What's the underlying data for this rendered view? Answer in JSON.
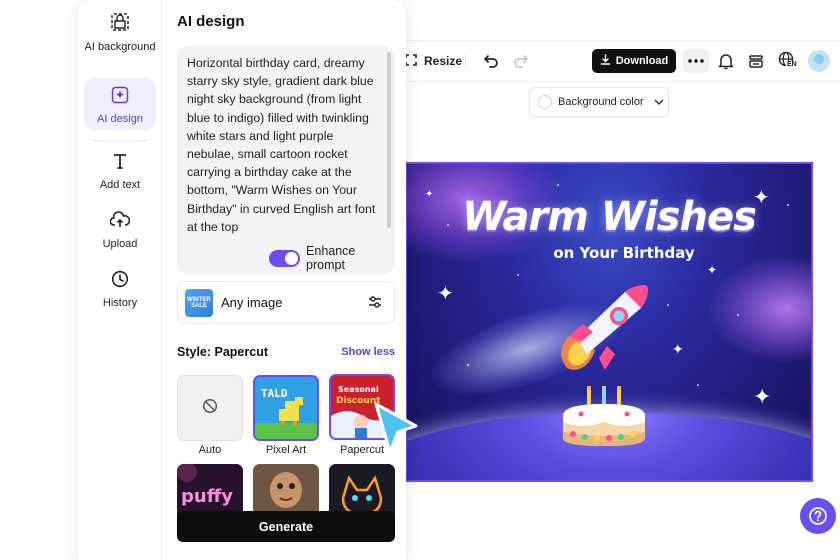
{
  "colors": {
    "accent": "#6d4cf0",
    "dark": "#111111",
    "rail_active_bg": "#f1efff"
  },
  "rail": {
    "items": [
      {
        "label": "AI background",
        "icon": "ai-background-icon"
      },
      {
        "label": "AI design",
        "icon": "ai-design-icon",
        "active": true
      },
      {
        "label": "Add text",
        "icon": "text-icon"
      },
      {
        "label": "Upload",
        "icon": "upload-icon"
      },
      {
        "label": "History",
        "icon": "history-icon"
      }
    ]
  },
  "panel": {
    "title": "AI design",
    "prompt": "Horizontal birthday card, dreamy starry sky style, gradient dark blue night sky background (from light blue to indigo) filled with twinkling white stars and light purple nebulae, small cartoon rocket carrying a birthday cake at the bottom, \"Warm Wishes on Your Birthday\" in curved English art font at the top",
    "enhance_label": "Enhance prompt",
    "enhance_on": true,
    "reference": {
      "label": "Any image",
      "thumb_text": "WINTER SALE"
    },
    "style_label": "Style: Papercut",
    "show_less": "Show less",
    "styles": [
      {
        "label": "Auto"
      },
      {
        "label": "Pixel Art",
        "thumb_text": "GEOVIS TALD"
      },
      {
        "label": "Papercut",
        "thumb_text": "Seasonal Discount",
        "selected": true
      },
      {
        "label": "",
        "thumb_text": "puffy"
      },
      {
        "label": ""
      },
      {
        "label": ""
      }
    ],
    "generate_label": "Generate"
  },
  "toolbar": {
    "resize_label": "Resize",
    "download_label": "Download",
    "language_badge": "EN"
  },
  "canvas": {
    "bg_color_label": "Background color",
    "title_main": "Warm Wishes",
    "title_sub": "on Your Birthday"
  }
}
